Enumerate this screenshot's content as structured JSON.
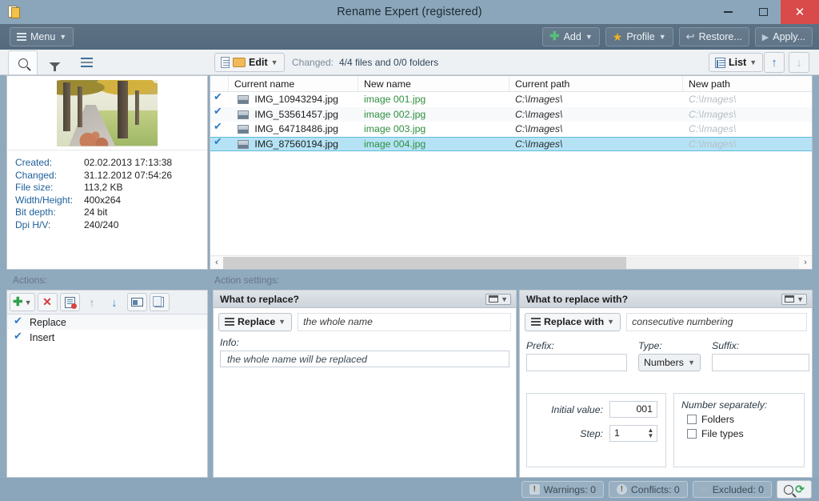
{
  "window": {
    "title": "Rename Expert (registered)",
    "app_icon": "document-folder-icon",
    "minimize": "−",
    "maximize": "▢",
    "close": "✕"
  },
  "ribbon": {
    "menu_label": "Menu",
    "add_label": "Add",
    "profile_label": "Profile",
    "restore_label": "Restore...",
    "apply_label": "Apply..."
  },
  "subtoolbar": {
    "search_tab": "search-icon",
    "filter_tab": "filter-icon",
    "list_tab": "list-lines-icon",
    "edit_label": "Edit",
    "changed_label": "Changed:",
    "changed_value": "4/4 files and 0/0 folders",
    "view_label": "List",
    "move_up": "↑",
    "move_down": "↓"
  },
  "preview": {
    "image_alt": "autumn tree lined road",
    "metadata": [
      {
        "key": "Created:",
        "value": "02.02.2013 17:13:38"
      },
      {
        "key": "Changed:",
        "value": "31.12.2012 07:54:26"
      },
      {
        "key": "File size:",
        "value": "113,2 KB"
      },
      {
        "key": "Width/Height:",
        "value": "400x264"
      },
      {
        "key": "Bit depth:",
        "value": "24 bit"
      },
      {
        "key": "Dpi H/V:",
        "value": "240/240"
      }
    ]
  },
  "filelist": {
    "columns": [
      "",
      "Current name",
      "New name",
      "Current path",
      "New path"
    ],
    "rows": [
      {
        "checked": true,
        "current_name": "IMG_10943294.jpg",
        "new_name": "image 001.jpg",
        "current_path": "C:\\Images\\",
        "new_path": "C:\\Images\\"
      },
      {
        "checked": true,
        "current_name": "IMG_53561457.jpg",
        "new_name": "image 002.jpg",
        "current_path": "C:\\Images\\",
        "new_path": "C:\\Images\\"
      },
      {
        "checked": true,
        "current_name": "IMG_64718486.jpg",
        "new_name": "image 003.jpg",
        "current_path": "C:\\Images\\",
        "new_path": "C:\\Images\\"
      },
      {
        "checked": true,
        "current_name": "IMG_87560194.jpg",
        "new_name": "image 004.jpg",
        "current_path": "C:\\Images\\",
        "new_path": "C:\\Images\\"
      }
    ],
    "scroll_left_arrow": "‹",
    "scroll_right_arrow": "›"
  },
  "actions": {
    "label": "Actions:",
    "toolbar": [
      "add-action-icon",
      "delete-action-icon",
      "clear-actions-icon",
      "move-up-icon",
      "move-down-icon",
      "rename-action-icon",
      "copy-action-icon"
    ],
    "items": [
      {
        "label": "Replace",
        "checked": true
      },
      {
        "label": "Insert",
        "checked": true
      }
    ]
  },
  "action_settings": {
    "label": "Action settings:",
    "what_to_replace": {
      "title": "What to replace?",
      "mode_label": "Replace",
      "mode_value": "the whole name",
      "info_label": "Info:",
      "info_value": "the whole name will be replaced"
    },
    "what_to_replace_with": {
      "title": "What to replace with?",
      "mode_label": "Replace with",
      "mode_value": "consecutive numbering",
      "prefix_label": "Prefix:",
      "prefix_value": "",
      "type_label": "Type:",
      "type_value": "Numbers",
      "suffix_label": "Suffix:",
      "suffix_value": "",
      "initial_value_label": "Initial value:",
      "initial_value": "001",
      "step_label": "Step:",
      "step_value": "1",
      "number_separately_label": "Number separately:",
      "number_separately": [
        {
          "label": "Folders",
          "checked": false
        },
        {
          "label": "File types",
          "checked": false
        }
      ]
    }
  },
  "status": {
    "warnings": "Warnings: 0",
    "conflicts": "Conflicts: 0",
    "excluded": "Excluded: 0",
    "search_refresh": "search-refresh-icon"
  },
  "colors": {
    "titlebar": "#8ba6ba",
    "ribbon": "#586e81",
    "accent_blue": "#2f7bc4",
    "new_name_green": "#2f8f3f",
    "selection": "#b5e3f5",
    "close_red": "#d94a4a"
  }
}
